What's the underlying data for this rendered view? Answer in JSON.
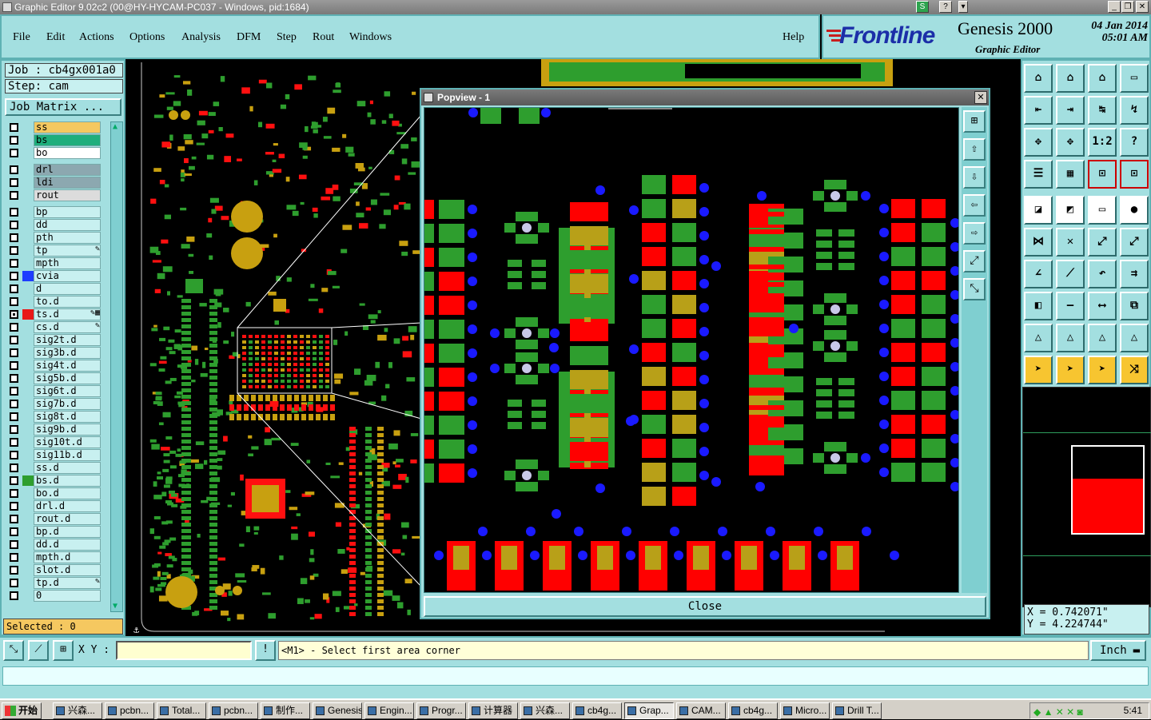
{
  "window": {
    "title": "Graphic Editor 9.02c2 (00@HY-HYCAM-PC037 - Windows, pid:1684)"
  },
  "menu": [
    "File",
    "Edit",
    "Actions",
    "Options",
    "Analysis",
    "DFM",
    "Step",
    "Rout",
    "Windows"
  ],
  "help": "Help",
  "brand": {
    "logo_main": "Frontline",
    "product": "Genesis 2000",
    "subtitle": "Graphic Editor",
    "date": "04 Jan 2014",
    "time": "05:01 AM"
  },
  "job": {
    "job_line": "Job : cb4gx001a0",
    "step_line": "Step: cam",
    "matrix_button": "Job Matrix ..."
  },
  "layers": [
    {
      "name": "ss",
      "bg": "#f5c860",
      "swatch": ""
    },
    {
      "name": "bs",
      "bg": "#1fae7c",
      "swatch": ""
    },
    {
      "name": "bo",
      "bg": "#ffffff",
      "swatch": ""
    },
    {
      "name": "drl",
      "bg": "#8ca8b0",
      "swatch": ""
    },
    {
      "name": "ldi",
      "bg": "#8ca8b0",
      "swatch": ""
    },
    {
      "name": "rout",
      "bg": "#dcdcdc",
      "swatch": ""
    },
    {
      "name": "bp",
      "bg": "",
      "swatch": ""
    },
    {
      "name": "dd",
      "bg": "",
      "swatch": ""
    },
    {
      "name": "pth",
      "bg": "",
      "swatch": ""
    },
    {
      "name": "tp",
      "bg": "",
      "swatch": "",
      "mark": "✎"
    },
    {
      "name": "mpth",
      "bg": "",
      "swatch": ""
    },
    {
      "name": "cvia",
      "bg": "",
      "swatch": "#1e3cff"
    },
    {
      "name": "d",
      "bg": "",
      "swatch": ""
    },
    {
      "name": "to.d",
      "bg": "",
      "swatch": ""
    },
    {
      "name": "ts.d",
      "bg": "",
      "swatch": "#e81818",
      "mark": "✎▦"
    },
    {
      "name": "cs.d",
      "bg": "",
      "swatch": "",
      "mark": "✎"
    },
    {
      "name": "sig2t.d",
      "bg": "",
      "swatch": ""
    },
    {
      "name": "sig3b.d",
      "bg": "",
      "swatch": ""
    },
    {
      "name": "sig4t.d",
      "bg": "",
      "swatch": ""
    },
    {
      "name": "sig5b.d",
      "bg": "",
      "swatch": ""
    },
    {
      "name": "sig6t.d",
      "bg": "",
      "swatch": ""
    },
    {
      "name": "sig7b.d",
      "bg": "",
      "swatch": ""
    },
    {
      "name": "sig8t.d",
      "bg": "",
      "swatch": ""
    },
    {
      "name": "sig9b.d",
      "bg": "",
      "swatch": ""
    },
    {
      "name": "sig10t.d",
      "bg": "",
      "swatch": ""
    },
    {
      "name": "sig11b.d",
      "bg": "",
      "swatch": ""
    },
    {
      "name": "ss.d",
      "bg": "",
      "swatch": ""
    },
    {
      "name": "bs.d",
      "bg": "",
      "swatch": "#2e9e2e"
    },
    {
      "name": "bo.d",
      "bg": "",
      "swatch": ""
    },
    {
      "name": "drl.d",
      "bg": "",
      "swatch": ""
    },
    {
      "name": "rout.d",
      "bg": "",
      "swatch": ""
    },
    {
      "name": "bp.d",
      "bg": "",
      "swatch": ""
    },
    {
      "name": "dd.d",
      "bg": "",
      "swatch": ""
    },
    {
      "name": "mpth.d",
      "bg": "",
      "swatch": ""
    },
    {
      "name": "slot.d",
      "bg": "",
      "swatch": ""
    },
    {
      "name": "tp.d",
      "bg": "",
      "swatch": "",
      "mark": "✎"
    },
    {
      "name": "0",
      "bg": "",
      "swatch": ""
    }
  ],
  "selected": "Selected : 0",
  "popview": {
    "title": "Popview - 1",
    "close_label": "Close",
    "close_x": "✕"
  },
  "coords": {
    "x": "X = 0.742071\"",
    "y": "Y = 4.224744\""
  },
  "cmd": {
    "xy_label": "X Y :",
    "xy_value": "",
    "bang": "!",
    "prompt": "<M1> - Select first area corner",
    "unit": "Inch"
  },
  "taskbar": {
    "start": "开始",
    "tasks": [
      "兴森...",
      "pcbn...",
      "Total...",
      "pcbn...",
      "制作...",
      "Genesis",
      "Engin...",
      "Progr...",
      "计算器",
      "兴森...",
      "cb4g...",
      "Grap...",
      "CAM...",
      "cb4g...",
      "Micro...",
      "Drill T..."
    ],
    "active_index": 11,
    "clock": "5:41"
  },
  "colors": {
    "panel": "#a3dfe0",
    "red": "#ff0000",
    "green": "#2e9e2e",
    "olive": "#b8a018",
    "blue": "#1a1aff"
  }
}
